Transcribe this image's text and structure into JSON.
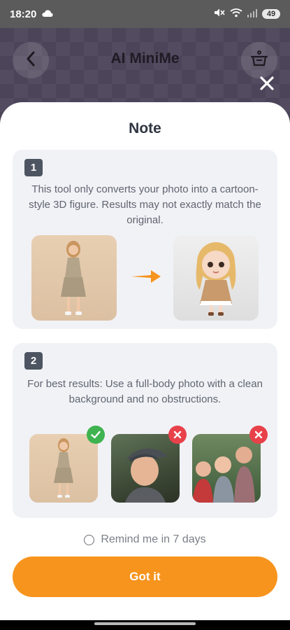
{
  "status_bar": {
    "time": "18:20",
    "battery": "49"
  },
  "background_screen": {
    "title": "AI MiniMe"
  },
  "sheet": {
    "title": "Note",
    "step1": {
      "number": "1",
      "text": "This tool only converts your photo into a cartoon-style 3D figure. Results may not exactly match the original."
    },
    "step2": {
      "number": "2",
      "text": "For best results: Use a full-body photo with a clean background and no obstructions."
    },
    "remind_label": "Remind me in 7 days",
    "button_label": "Got it"
  },
  "colors": {
    "accent": "#f7941d",
    "ok": "#3fb34f",
    "bad": "#e8414a",
    "card": "#f1f2f6"
  }
}
